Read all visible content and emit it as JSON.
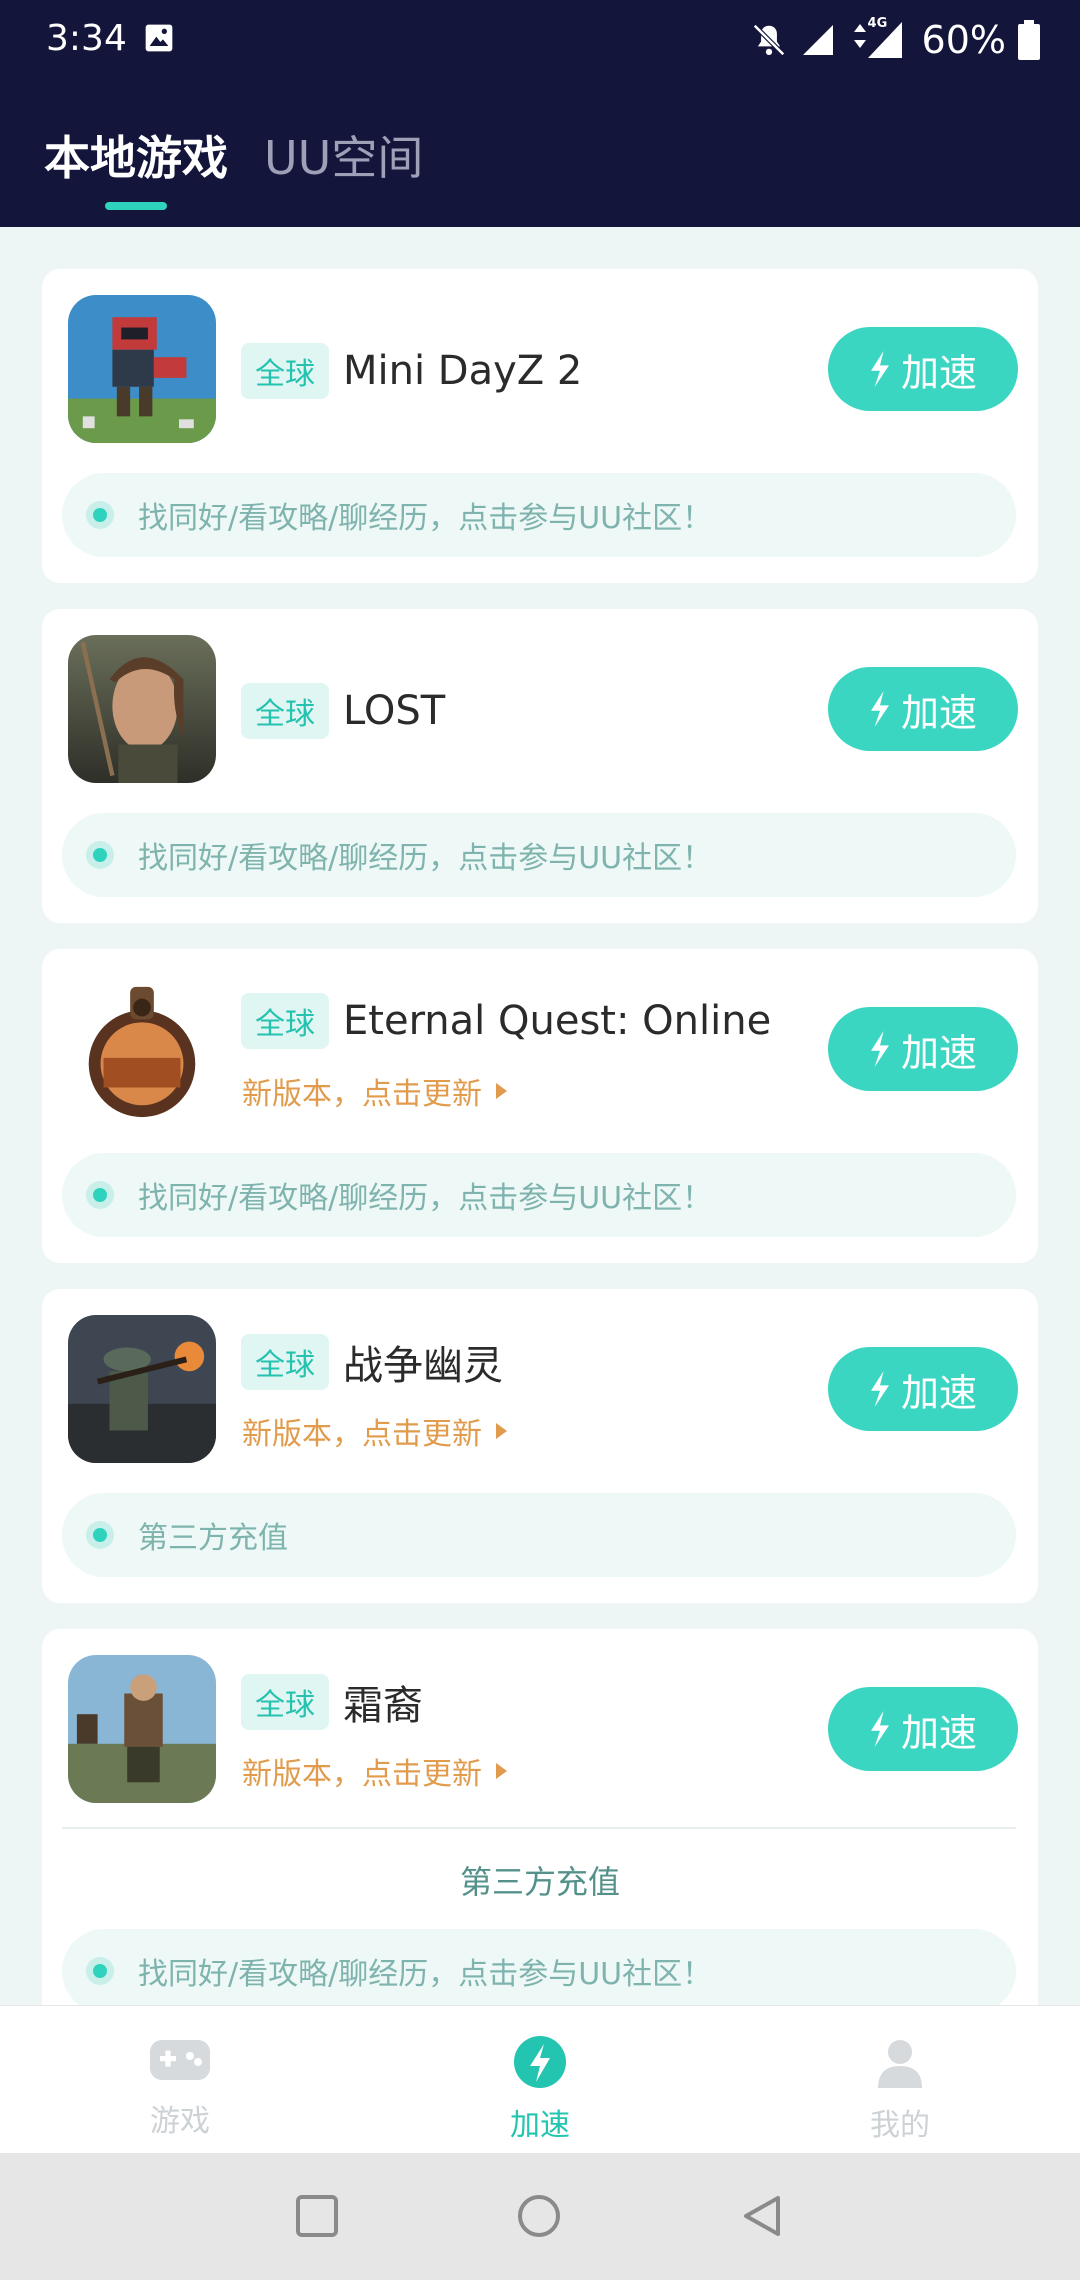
{
  "status_bar": {
    "time": "3:34",
    "network": "4G",
    "battery": "60%"
  },
  "tabs": [
    {
      "label": "本地游戏",
      "active": true
    },
    {
      "label": "UU空间",
      "active": false
    }
  ],
  "games": [
    {
      "region": "全球",
      "name": "Mini DayZ 2",
      "update": "",
      "button": "加速",
      "community": "找同好/看攻略/聊经历，点击参与UU社区！"
    },
    {
      "region": "全球",
      "name": "LOST",
      "update": "",
      "button": "加速",
      "community": "找同好/看攻略/聊经历，点击参与UU社区！"
    },
    {
      "region": "全球",
      "name": "Eternal Quest: Online",
      "update": "新版本，点击更新",
      "button": "加速",
      "community": "找同好/看攻略/聊经历，点击参与UU社区！"
    },
    {
      "region": "全球",
      "name": "战争幽灵",
      "update": "新版本，点击更新",
      "button": "加速",
      "community": "第三方充值"
    },
    {
      "region": "全球",
      "name": "霜裔",
      "update": "新版本，点击更新",
      "button": "加速",
      "recharge": "第三方充值",
      "community": "找同好/看攻略/聊经历，点击参与UU社区！"
    }
  ],
  "bottom_nav": [
    {
      "label": "游戏",
      "icon": "gamepad-icon",
      "active": false
    },
    {
      "label": "加速",
      "icon": "lightning-icon",
      "active": true
    },
    {
      "label": "我的",
      "icon": "person-icon",
      "active": false
    }
  ],
  "colors": {
    "accent": "#3ad6c1",
    "header_bg": "#13163a",
    "update_text": "#e09b4c"
  }
}
